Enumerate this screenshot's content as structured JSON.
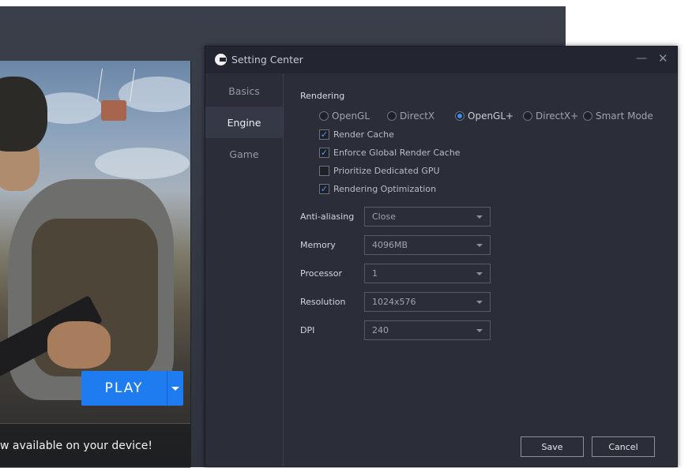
{
  "game": {
    "play_label": "PLAY",
    "promo_text": "w available on your device!"
  },
  "dialog": {
    "title": "Setting Center",
    "minimize_glyph": "—",
    "close_glyph": "✕",
    "nav": [
      {
        "label": "Basics",
        "active": false
      },
      {
        "label": "Engine",
        "active": true
      },
      {
        "label": "Game",
        "active": false
      }
    ],
    "rendering": {
      "label": "Rendering",
      "modes": [
        "OpenGL",
        "DirectX",
        "OpenGL+",
        "DirectX+",
        "Smart Mode"
      ],
      "selected_mode": "OpenGL+",
      "options": [
        {
          "label": "Render Cache",
          "checked": true
        },
        {
          "label": "Enforce Global Render Cache",
          "checked": true
        },
        {
          "label": "Prioritize Dedicated GPU",
          "checked": false
        },
        {
          "label": "Rendering Optimization",
          "checked": true
        }
      ]
    },
    "fields": [
      {
        "label": "Anti-aliasing",
        "value": "Close"
      },
      {
        "label": "Memory",
        "value": "4096MB"
      },
      {
        "label": "Processor",
        "value": "1"
      },
      {
        "label": "Resolution",
        "value": "1024x576"
      },
      {
        "label": "DPI",
        "value": "240"
      }
    ],
    "save_label": "Save",
    "cancel_label": "Cancel"
  },
  "colors": {
    "accent": "#1f7cf0",
    "dialog_bg": "#2b2e39",
    "titlebar_bg": "#232630",
    "check_color": "#4a9cff"
  }
}
